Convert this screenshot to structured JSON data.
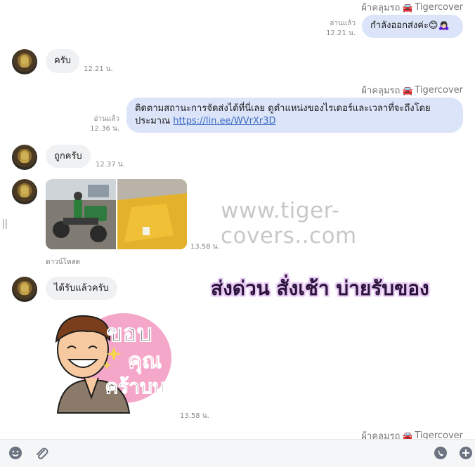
{
  "messages": {
    "m1": {
      "sender": "ผ้าคลุมรถ",
      "sender_brand": "Tigercover",
      "read": "อ่านแล้ว",
      "time": "12.21 น.",
      "text": "กำลังออกส่งค่ะ😊🙇🏻‍♀️"
    },
    "m2": {
      "text": "ครับ",
      "time": "12.21 น."
    },
    "m3": {
      "sender": "ผ้าคลุมรถ",
      "sender_brand": "Tigercover",
      "read": "อ่านแล้ว",
      "time": "12.36 น.",
      "text_line1": "ติดตามสถานะการจัดส่งได้ที่นี่เลย ดูตำแหน่งของไรเดอร์และเวลาที่จะถึงโดย",
      "text_line2_prefix": "ประมาณ ",
      "link": "https://lin.ee/WVrXr3D"
    },
    "m4": {
      "text": "ถูกครับ",
      "time": "12.37 น."
    },
    "m5": {
      "time": "13.58 น.",
      "download": "ดาวน์โหลด"
    },
    "m6": {
      "text": "ได้รับแล้วครับ"
    },
    "m7": {
      "time": "13.58 น.",
      "sticker_text1": "ขอบ",
      "sticker_text2": "คุณ",
      "sticker_text3": "คร้าบบ"
    },
    "m8": {
      "sender": "ผ้าคลุมรถ",
      "sender_brand": "Tigercover"
    }
  },
  "overlay": {
    "watermark": "www.tiger-covers..com",
    "promo": "ส่งด่วน สั่งเช้า บ่ายรับของ"
  },
  "icons": {
    "sender_car": "car-icon",
    "emoji": "emoji-icon",
    "attach": "paperclip-icon",
    "voice": "phone-icon",
    "add": "plus-icon"
  },
  "colors": {
    "out_bubble": "#dbe4f8",
    "in_bubble": "#f0f1f3",
    "link": "#3b69c6"
  }
}
